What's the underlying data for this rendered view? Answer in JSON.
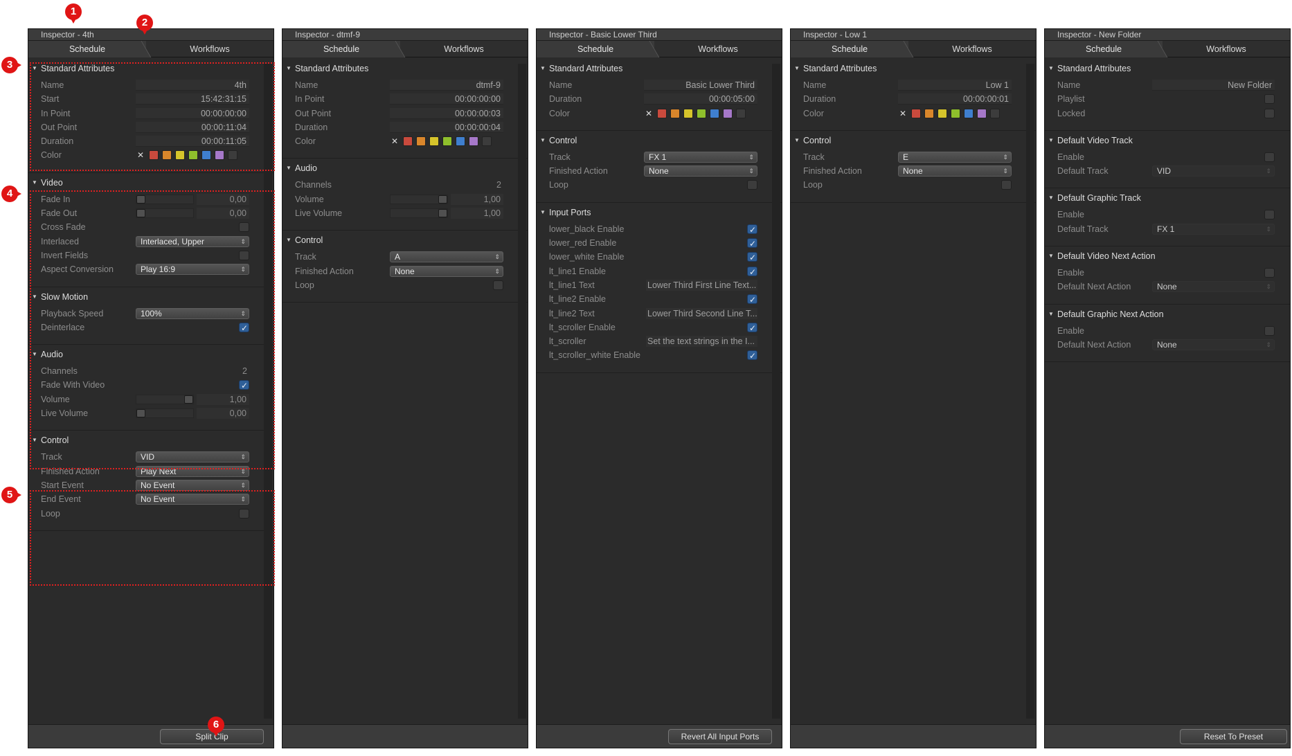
{
  "panels": [
    {
      "title": "Inspector - 4th",
      "tabs": [
        "Schedule",
        "Workflows"
      ],
      "footer_button": "Split Clip",
      "standard": {
        "header": "Standard Attributes",
        "name_label": "Name",
        "name": "4th",
        "start_label": "Start",
        "start": "15:42:31:15",
        "inpoint_label": "In Point",
        "inpoint": "00:00:00:00",
        "outpoint_label": "Out Point",
        "outpoint": "00:00:11:04",
        "duration_label": "Duration",
        "duration": "00:00:11:05",
        "color_label": "Color"
      },
      "video": {
        "header": "Video",
        "fadein_label": "Fade In",
        "fadein": "0,00",
        "fadeout_label": "Fade Out",
        "fadeout": "0,00",
        "crossfade_label": "Cross Fade",
        "interlaced_label": "Interlaced",
        "interlaced": "Interlaced, Upper",
        "invert_label": "Invert Fields",
        "aspect_label": "Aspect Conversion",
        "aspect": "Play 16:9"
      },
      "slowmo": {
        "header": "Slow Motion",
        "speed_label": "Playback Speed",
        "speed": "100%",
        "deinterlace_label": "Deinterlace"
      },
      "audio": {
        "header": "Audio",
        "channels_label": "Channels",
        "channels": "2",
        "fade_label": "Fade With Video",
        "volume_label": "Volume",
        "volume": "1,00",
        "live_label": "Live Volume",
        "live": "0,00"
      },
      "control": {
        "header": "Control",
        "track_label": "Track",
        "track": "VID",
        "finished_label": "Finished Action",
        "finished": "Play Next",
        "start_event_label": "Start Event",
        "start_event": "No Event",
        "end_event_label": "End Event",
        "end_event": "No Event",
        "loop_label": "Loop"
      }
    },
    {
      "title": "Inspector - dtmf-9",
      "tabs": [
        "Schedule",
        "Workflows"
      ],
      "standard": {
        "header": "Standard Attributes",
        "name_label": "Name",
        "name": "dtmf-9",
        "inpoint_label": "In Point",
        "inpoint": "00:00:00:00",
        "outpoint_label": "Out Point",
        "outpoint": "00:00:00:03",
        "duration_label": "Duration",
        "duration": "00:00:00:04",
        "color_label": "Color"
      },
      "audio": {
        "header": "Audio",
        "channels_label": "Channels",
        "channels": "2",
        "volume_label": "Volume",
        "volume": "1,00",
        "live_label": "Live Volume",
        "live": "1,00"
      },
      "control": {
        "header": "Control",
        "track_label": "Track",
        "track": "A",
        "finished_label": "Finished Action",
        "finished": "None",
        "loop_label": "Loop"
      }
    },
    {
      "title": "Inspector - Basic Lower Third",
      "tabs": [
        "Schedule",
        "Workflows"
      ],
      "footer_button": "Revert All Input Ports",
      "standard": {
        "header": "Standard Attributes",
        "name_label": "Name",
        "name": "Basic Lower Third",
        "duration_label": "Duration",
        "duration": "00:00:05:00",
        "color_label": "Color"
      },
      "control": {
        "header": "Control",
        "track_label": "Track",
        "track": "FX 1",
        "finished_label": "Finished Action",
        "finished": "None",
        "loop_label": "Loop"
      },
      "ports": {
        "header": "Input Ports",
        "items": [
          {
            "label": "lower_black Enable",
            "type": "check"
          },
          {
            "label": "lower_red Enable",
            "type": "check"
          },
          {
            "label": "lower_white Enable",
            "type": "check"
          },
          {
            "label": "lt_line1 Enable",
            "type": "check"
          },
          {
            "label": "lt_line1 Text",
            "type": "text",
            "value": "Lower Third First Line Text..."
          },
          {
            "label": "lt_line2 Enable",
            "type": "check"
          },
          {
            "label": "lt_line2 Text",
            "type": "text",
            "value": "Lower Third Second Line T..."
          },
          {
            "label": "lt_scroller Enable",
            "type": "check"
          },
          {
            "label": "lt_scroller",
            "type": "text",
            "value": "Set the text strings in the I..."
          },
          {
            "label": "lt_scroller_white Enable",
            "type": "check"
          }
        ]
      }
    },
    {
      "title": "Inspector - Low 1",
      "tabs": [
        "Schedule",
        "Workflows"
      ],
      "standard": {
        "header": "Standard Attributes",
        "name_label": "Name",
        "name": "Low 1",
        "duration_label": "Duration",
        "duration": "00:00:00:01",
        "color_label": "Color"
      },
      "control": {
        "header": "Control",
        "track_label": "Track",
        "track": "E",
        "finished_label": "Finished Action",
        "finished": "None",
        "loop_label": "Loop"
      }
    },
    {
      "title": "Inspector - New Folder",
      "tabs": [
        "Schedule",
        "Workflows"
      ],
      "footer_button": "Reset To Preset",
      "standard": {
        "header": "Standard Attributes",
        "name_label": "Name",
        "name": "New Folder",
        "playlist_label": "Playlist",
        "locked_label": "Locked"
      },
      "dvt": {
        "header": "Default Video Track",
        "enable_label": "Enable",
        "track_label": "Default Track",
        "track": "VID"
      },
      "dgt": {
        "header": "Default Graphic Track",
        "enable_label": "Enable",
        "track_label": "Default Track",
        "track": "FX 1"
      },
      "dvna": {
        "header": "Default Video Next Action",
        "enable_label": "Enable",
        "action_label": "Default Next Action",
        "action": "None"
      },
      "dgna": {
        "header": "Default Graphic Next Action",
        "enable_label": "Enable",
        "action_label": "Default Next Action",
        "action": "None"
      }
    }
  ],
  "swatch_colors": [
    "#c94a3d",
    "#d9862b",
    "#d6c42b",
    "#8fbf2c",
    "#3f7fcf",
    "#a678c9",
    "#3c3c3c"
  ],
  "markers": [
    "1",
    "2",
    "3",
    "4",
    "5",
    "6"
  ]
}
